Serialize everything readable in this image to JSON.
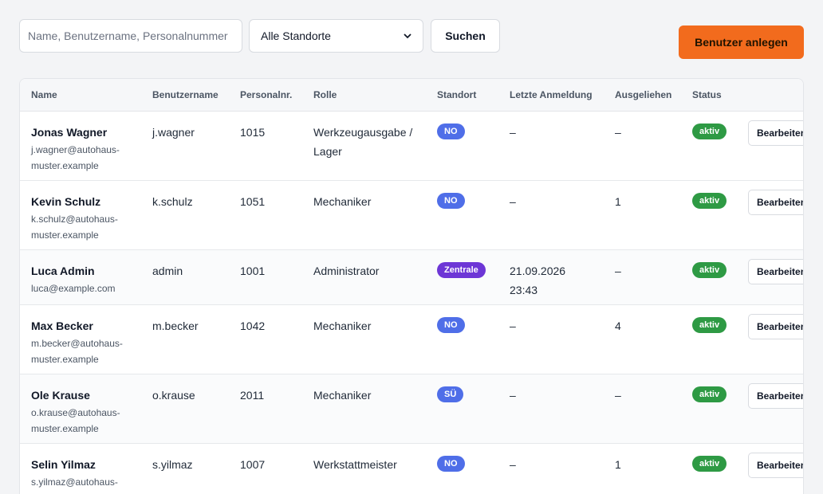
{
  "toolbar": {
    "search_placeholder": "Name, Benutzername, Personalnummer",
    "location_selected": "Alle Standorte",
    "search_label": "Suchen",
    "create_label": "Benutzer anlegen",
    "create_color": "#f26b1d"
  },
  "table": {
    "headers": [
      "Name",
      "Benutzername",
      "Personalnr.",
      "Rolle",
      "Standort",
      "Letzte Anmeldung",
      "Ausgeliehen",
      "Status"
    ],
    "rows": [
      {
        "name": "Jonas Wagner",
        "email": "j.wagner@autohaus-muster.example",
        "username": "j.wagner",
        "personnel_no": "1015",
        "role": "Werkzeugausgabe / Lager",
        "location": "NO",
        "last_login": "–",
        "borrowed": "–",
        "status": "aktiv",
        "action": "Bearbeiten"
      },
      {
        "name": "Kevin Schulz",
        "email": "k.schulz@autohaus-muster.example",
        "username": "k.schulz",
        "personnel_no": "1051",
        "role": "Mechaniker",
        "location": "NO",
        "last_login": "–",
        "borrowed": "1",
        "status": "aktiv",
        "action": "Bearbeiten"
      },
      {
        "name": "Luca Admin",
        "email": "luca@example.com",
        "username": "admin",
        "personnel_no": "1001",
        "role": "Administrator",
        "location": "Zentrale",
        "last_login": "21.09.2026 23:43",
        "borrowed": "–",
        "status": "aktiv",
        "action": "Bearbeiten"
      },
      {
        "name": "Max Becker",
        "email": "m.becker@autohaus-muster.example",
        "username": "m.becker",
        "personnel_no": "1042",
        "role": "Mechaniker",
        "location": "NO",
        "last_login": "–",
        "borrowed": "4",
        "status": "aktiv",
        "action": "Bearbeiten"
      },
      {
        "name": "Ole Krause",
        "email": "o.krause@autohaus-muster.example",
        "username": "o.krause",
        "personnel_no": "2011",
        "role": "Mechaniker",
        "location": "SÜ",
        "last_login": "–",
        "borrowed": "–",
        "status": "aktiv",
        "action": "Bearbeiten"
      },
      {
        "name": "Selin Yilmaz",
        "email": "s.yilmaz@autohaus-muster.example",
        "username": "s.yilmaz",
        "personnel_no": "1007",
        "role": "Werkstattmeister",
        "location": "NO",
        "last_login": "–",
        "borrowed": "1",
        "status": "aktiv",
        "action": "Bearbeiten"
      }
    ]
  },
  "colors": {
    "badge_location": "#4f6ee8",
    "badge_zentrale": "#6d36d6",
    "badge_active": "#2e9a44"
  }
}
